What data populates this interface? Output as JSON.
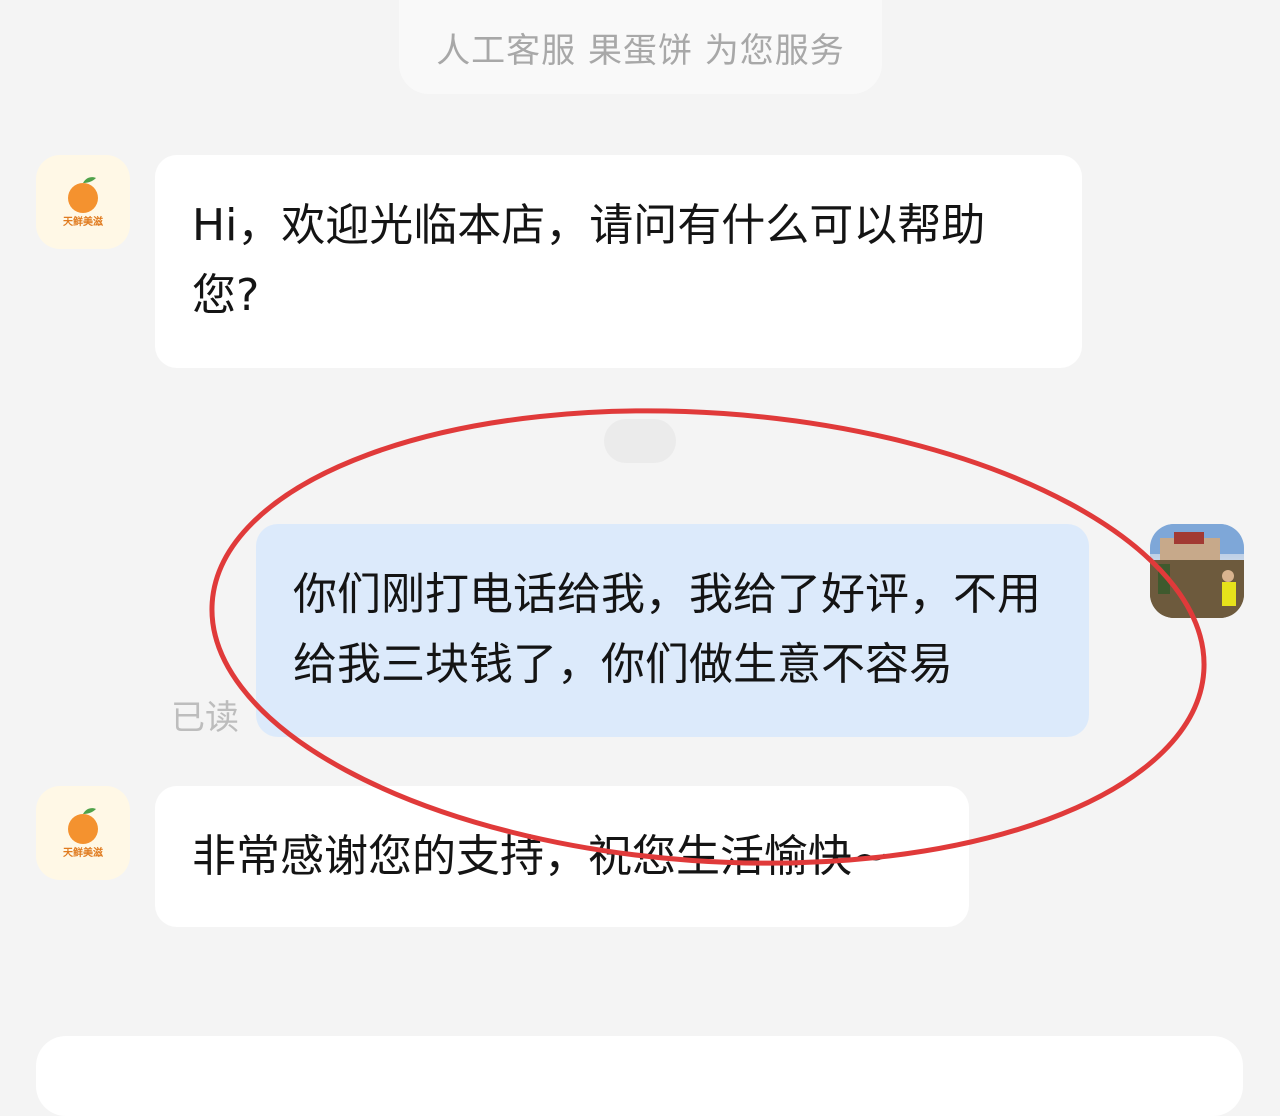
{
  "header": {
    "service_text": "人工客服 果蛋饼 为您服务"
  },
  "shop": {
    "logo_text": "天鲜美滋",
    "logo_color": "#f4922f"
  },
  "messages": [
    {
      "sender": "shop",
      "text": "Hi，欢迎光临本店，请问有什么可以帮助您?"
    },
    {
      "sender": "user",
      "text": "你们刚打电话给我，我给了好评，不用给我三块钱了，你们做生意不容易",
      "status": "已读"
    },
    {
      "sender": "shop",
      "text": "非常感谢您的支持，祝您生活愉快~"
    }
  ],
  "colors": {
    "background": "#f4f4f4",
    "incoming_bubble": "#ffffff",
    "outgoing_bubble": "#dceafb",
    "annotation_circle": "#e03a3a"
  }
}
